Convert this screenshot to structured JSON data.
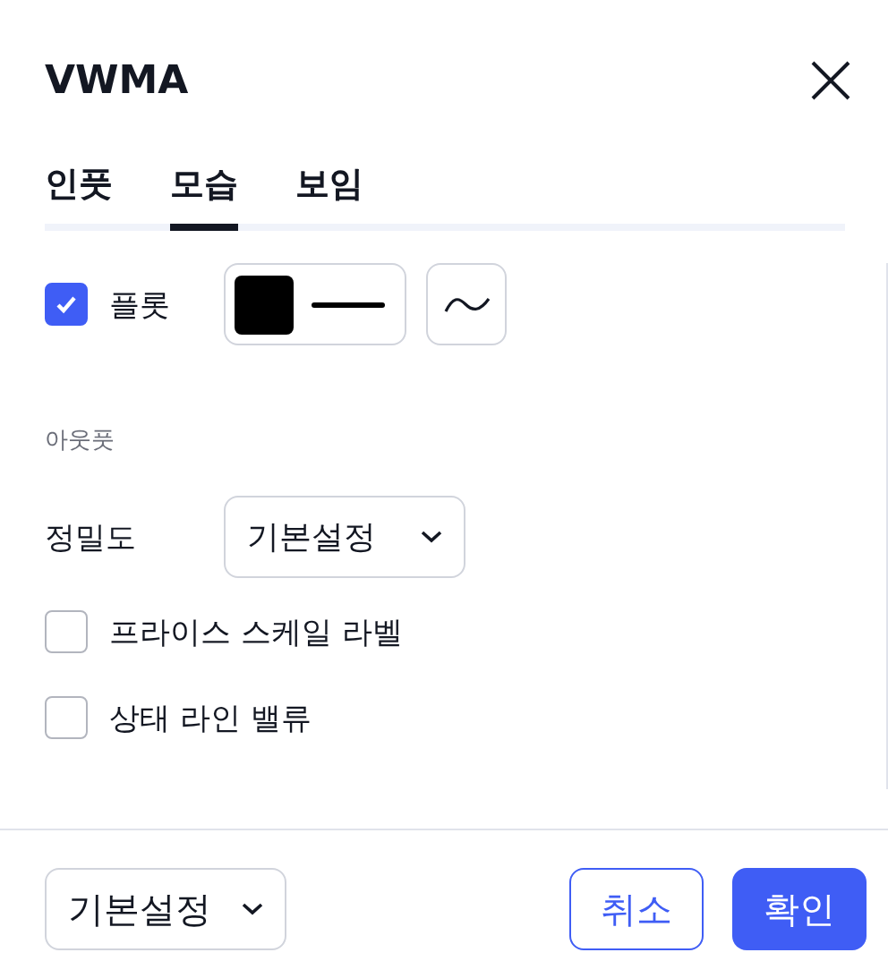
{
  "dialog": {
    "title": "VWMA"
  },
  "tabs": [
    {
      "label": "인풋",
      "selected": false
    },
    {
      "label": "모습",
      "selected": true
    },
    {
      "label": "보임",
      "selected": false
    }
  ],
  "rows": [
    {
      "kind": "plot",
      "label": "플롯",
      "checked": true
    },
    {
      "kind": "section",
      "label": "아웃풋"
    },
    {
      "kind": "select",
      "label": "정밀도",
      "value": "기본설정"
    },
    {
      "kind": "checkbox",
      "label": "프라이스 스케일 라벨",
      "checked": false
    },
    {
      "kind": "checkbox",
      "label": "상태 라인 밸류",
      "checked": false
    }
  ],
  "footer": {
    "preset": "기본설정",
    "buttons": [
      {
        "label": "취소",
        "kind": "secondary"
      },
      {
        "label": "확인",
        "kind": "primary"
      }
    ]
  }
}
